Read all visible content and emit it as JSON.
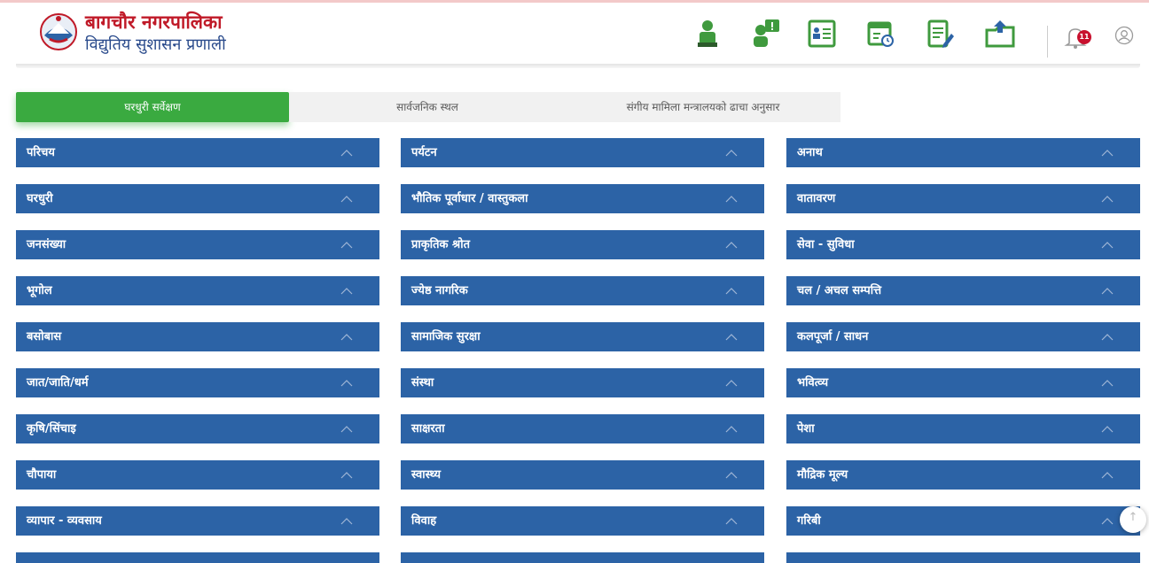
{
  "header": {
    "title": "बागचौर नगरपालिका",
    "subtitle": "विद्युतिय सुशासन प्रणाली",
    "notification_count": "11"
  },
  "tabs": [
    {
      "label": "घरधुरी सर्वेक्षण",
      "active": true
    },
    {
      "label": "सार्वजनिक स्थल",
      "active": false
    },
    {
      "label": "संगीय मामिला मन्त्रालयको ढाचा अनुसार",
      "active": false
    }
  ],
  "accordion": {
    "col1": [
      "परिचय",
      "घरधुरी",
      "जनसंख्या",
      "भूगोल",
      "बसोबास",
      "जात/जाति/धर्म",
      "कृषि/सिंचाइ",
      "चौपाया",
      "व्यापार - व्यवसाय"
    ],
    "col2": [
      "पर्यटन",
      "भौतिक पूर्वाधार / वास्तुकला",
      "प्राकृतिक श्रोत",
      "ज्येष्ठ नागरिक",
      "सामाजिक सुरक्षा",
      "संस्था",
      "साक्षरता",
      "स्वास्थ्य",
      "विवाह"
    ],
    "col3": [
      "अनाथ",
      "वातावरण",
      "सेवा - सुविधा",
      "चल / अचल सम्पत्ति",
      "कलपूर्जा / साधन",
      "भवित्व्य",
      "पेशा",
      "मौद्रिक मूल्य",
      "गरिबी"
    ]
  },
  "colors": {
    "panel": "#2c63a6",
    "active_tab": "#3aaa40",
    "brand": "#c01a28"
  }
}
